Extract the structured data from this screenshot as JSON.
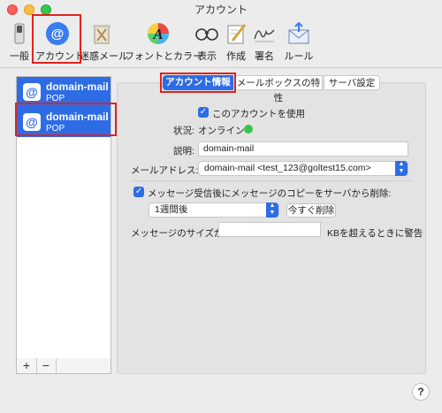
{
  "window": {
    "title": "アカウント"
  },
  "toolbar": {
    "items": [
      {
        "label": "一般",
        "icon": "general-switch-icon"
      },
      {
        "label": "アカウント",
        "icon": "at-sign-icon"
      },
      {
        "label": "迷惑メール",
        "icon": "junk-trash-icon"
      },
      {
        "label": "フォントとカラー",
        "icon": "font-color-icon"
      },
      {
        "label": "表示",
        "icon": "glasses-icon"
      },
      {
        "label": "作成",
        "icon": "compose-pencil-icon"
      },
      {
        "label": "署名",
        "icon": "signature-icon"
      },
      {
        "label": "ルール",
        "icon": "rules-envelope-icon"
      }
    ]
  },
  "accounts": [
    {
      "name": "domain-mail",
      "type": "POP"
    },
    {
      "name": "domain-mail",
      "type": "POP"
    }
  ],
  "list_footer": {
    "add": "+",
    "remove": "−"
  },
  "tabs": [
    {
      "label": "アカウント情報"
    },
    {
      "label": "メールボックスの特性"
    },
    {
      "label": "サーバ設定"
    }
  ],
  "form": {
    "enable_label": "このアカウントを使用",
    "status_label": "状況:",
    "status_value": "オンライン",
    "description_label": "説明:",
    "description_value": "domain-mail",
    "email_label": "メールアドレス:",
    "email_value": "domain-mail <test_123@goltest15.com>",
    "remove_copy_label": "メッセージ受信後にメッセージのコピーをサーバから削除:",
    "period_value": "1週間後",
    "remove_now_label": "今すぐ削除",
    "size_label": "メッセージのサイズが",
    "size_suffix": "KBを超えるときに警告",
    "size_value": ""
  },
  "help": "?",
  "colors": {
    "accent": "#2e6ce6",
    "highlight": "#e0231c",
    "status_online": "#3bc24a"
  }
}
